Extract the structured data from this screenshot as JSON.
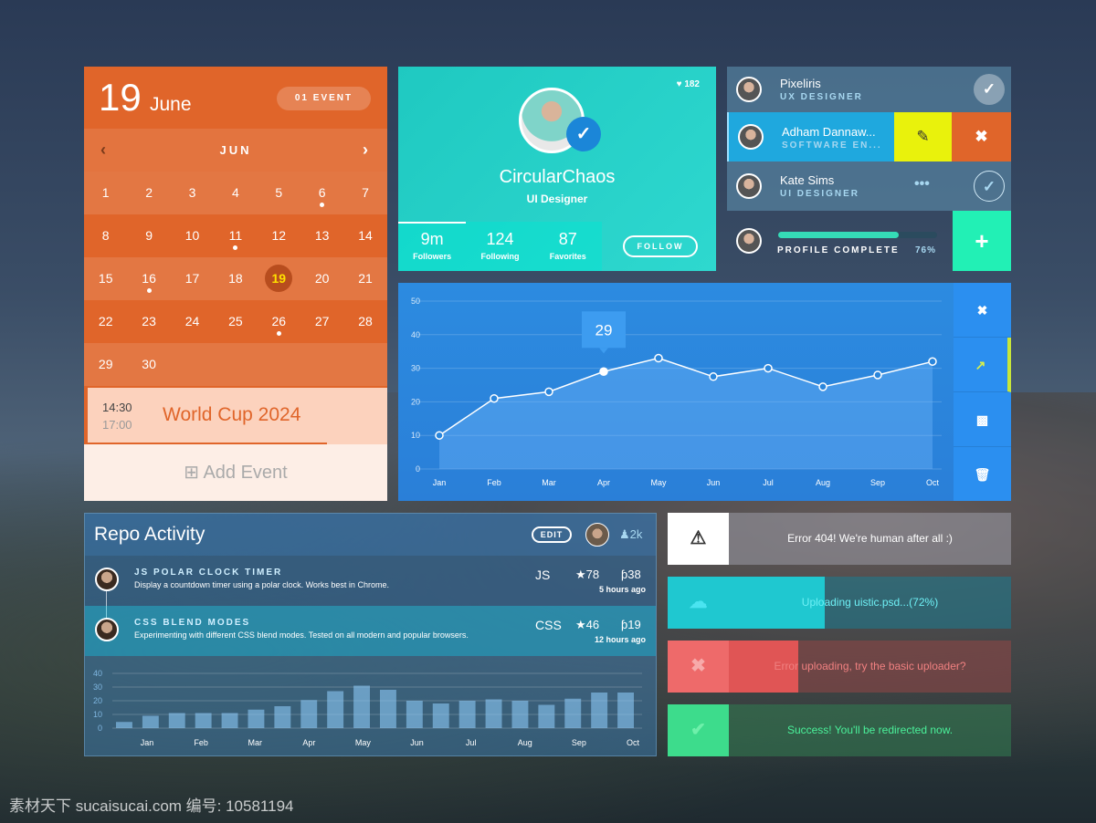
{
  "calendar": {
    "day": "19",
    "month": "June",
    "event_badge": "01 EVENT",
    "nav_month": "JUN",
    "prev_icon": "chevron-left-icon",
    "next_icon": "chevron-right-icon",
    "weeks": [
      [
        "1",
        "2",
        "3",
        "4",
        "5",
        "6",
        "7"
      ],
      [
        "8",
        "9",
        "10",
        "11",
        "12",
        "13",
        "14"
      ],
      [
        "15",
        "16",
        "17",
        "18",
        "19",
        "20",
        "21"
      ],
      [
        "22",
        "23",
        "24",
        "25",
        "26",
        "27",
        "28"
      ],
      [
        "29",
        "30"
      ]
    ],
    "event_days": [
      "6",
      "11",
      "16",
      "26"
    ],
    "selected_day": "19",
    "event": {
      "start": "14:30",
      "end": "17:00",
      "title": "World Cup 2024"
    },
    "add_event_label": "Add Event",
    "accent": "#e0652a"
  },
  "profile": {
    "likes": "182",
    "name": "CircularChaos",
    "role": "UI Designer",
    "stats": [
      {
        "value": "9m",
        "label": "Followers"
      },
      {
        "value": "124",
        "label": "Following"
      },
      {
        "value": "87",
        "label": "Favorites"
      }
    ],
    "follow_label": "FOLLOW"
  },
  "users": {
    "items": [
      {
        "name": "Pixeliris",
        "role": "UX DESIGNER",
        "status": "approved"
      },
      {
        "name": "Adham Dannaw...",
        "role": "SOFTWARE EN...",
        "status": "editing"
      },
      {
        "name": "Kate Sims",
        "role": "UI DESIGNER",
        "status": "pending"
      }
    ],
    "profile_complete_label": "PROFILE COMPLETE",
    "profile_complete_percent": "76%",
    "profile_complete_value": 76
  },
  "line_chart": {
    "sidebar_icons": [
      "close-icon",
      "line-chart-icon",
      "money-icon",
      "trash-icon"
    ],
    "tooltip": "29"
  },
  "repo": {
    "title": "Repo Activity",
    "edit_label": "EDIT",
    "followers": "2k",
    "items": [
      {
        "name": "JS POLAR CLOCK TIMER",
        "desc": "Display a countdown timer using a polar clock. Works best in Chrome.",
        "lang": "JS",
        "stars": "78",
        "forks": "38",
        "time": "5 hours ago"
      },
      {
        "name": "CSS BLEND MODES",
        "desc": "Experimenting with different CSS blend modes. Tested on all modern and popular browsers.",
        "lang": "CSS",
        "stars": "46",
        "forks": "19",
        "time": "12 hours ago"
      }
    ]
  },
  "notifications": [
    {
      "type": "warning",
      "text": "Error 404! We're human after all :)",
      "color": "#ffffff"
    },
    {
      "type": "upload",
      "text": "Uploading uistic.psd...(72%)",
      "progress": 72,
      "color": "#1fc8d0"
    },
    {
      "type": "error",
      "text": "Error uploading, try the basic uploader?",
      "color": "#ee6a6a"
    },
    {
      "type": "success",
      "text": "Success! You'll be redirected now.",
      "color": "#3ddc8c"
    }
  ],
  "watermark": "素材天下 sucaisucai.com  编号: 10581194",
  "chart_data": [
    {
      "type": "area",
      "categories": [
        "Jan",
        "Feb",
        "Mar",
        "Apr",
        "May",
        "Jun",
        "Jul",
        "Aug",
        "Sep",
        "Oct"
      ],
      "values": [
        10,
        21,
        23,
        29,
        33,
        27.5,
        30,
        24.5,
        28,
        32
      ],
      "ylim": [
        0,
        50
      ],
      "yticks": [
        "0",
        "10",
        "20",
        "30",
        "40",
        "50"
      ],
      "grid": true
    },
    {
      "type": "bar",
      "categories": [
        "Jan",
        "Feb",
        "Mar",
        "Apr",
        "May",
        "Jun",
        "Jul",
        "Aug",
        "Sep",
        "Oct"
      ],
      "values": [
        4.5,
        9,
        11,
        11,
        11,
        13.5,
        16,
        20.5,
        27,
        31,
        28,
        20,
        18,
        20,
        21,
        20,
        17,
        21.5,
        26,
        26
      ],
      "ylim": [
        0,
        40
      ],
      "yticks": [
        "0",
        "10",
        "20",
        "30",
        "40"
      ],
      "grid": true
    }
  ]
}
